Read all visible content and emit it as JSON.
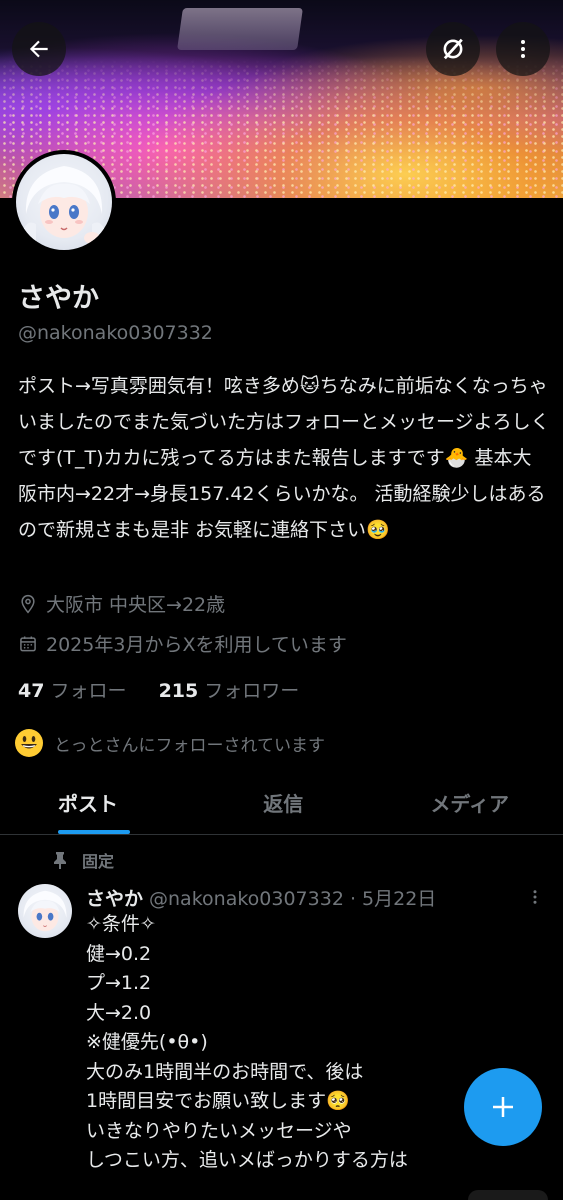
{
  "profile": {
    "display_name": "さやか",
    "handle": "@nakonako0307332",
    "bio": "ポスト→写真雰囲気有！呟き多め🐱ちなみに前垢なくなっちゃいましたのでまた気づいた方はフォローとメッセージよろしくです(T_T)カカに残ってる方はまた報告しますです🐣 基本大阪市内→22才→身長157.42くらいかな。 活動経験少しはあるので新規さまも是非 お気軽に連絡下さい🥹",
    "location": "大阪市 中央区→22歳",
    "joined": "2025年3月からXを利用しています",
    "following_count": "47",
    "following_label": "フォロー",
    "followers_count": "215",
    "followers_label": "フォロワー",
    "followed_by": "とっとさんにフォローされています"
  },
  "tabs": [
    {
      "label": "ポスト",
      "active": true
    },
    {
      "label": "返信",
      "active": false
    },
    {
      "label": "メディア",
      "active": false
    }
  ],
  "pinned_post": {
    "pinned_label": "固定",
    "author": "さやか",
    "handle_date": "@nakonako0307332 · 5月22日",
    "lines": [
      "✧条件✧",
      "健→0.2",
      "プ→1.2",
      "大→2.0",
      "※健優先(•θ•)",
      "大のみ1時間半のお時間で、後は",
      "1時間目安でお願い致します🥺",
      "いきなりやりたいメッセージや",
      "しつこい方、追いメばっかりする方は"
    ]
  },
  "colors": {
    "accent": "#1d9bf0",
    "text_primary": "#e7e9ea",
    "text_secondary": "#71767b",
    "background": "#000000",
    "divider": "#2f3336"
  },
  "icons": {
    "back": "arrow-left-icon",
    "grok": "grok-icon",
    "more": "more-vertical-icon",
    "location": "location-pin-icon",
    "calendar": "calendar-icon",
    "pin": "pin-icon",
    "compose": "plus-icon",
    "followed_by_emoji": "grinning-face-icon"
  }
}
